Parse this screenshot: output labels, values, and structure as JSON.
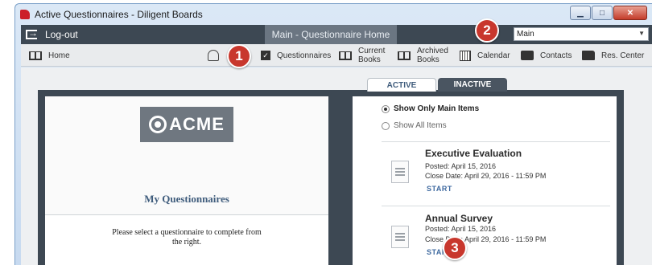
{
  "window": {
    "title": "Active Questionnaires - Diligent Boards"
  },
  "topbar": {
    "logout_label": "Log-out",
    "main_tab_label": "Main - Questionnaire Home",
    "book_select_value": "Main"
  },
  "nav": {
    "home": "Home",
    "questionnaires": "Questionnaires",
    "current_books": [
      "Current",
      "Books"
    ],
    "archived_books": [
      "Archived",
      "Books"
    ],
    "calendar": "Calendar",
    "contacts": "Contacts",
    "res_center": "Res. Center"
  },
  "tabs": {
    "active": "ACTIVE",
    "inactive": "INACTIVE"
  },
  "left_panel": {
    "logo_text": "ACME",
    "heading": "My Questionnaires",
    "instruction": "Please select a questionnaire to complete from the right."
  },
  "filters": {
    "main_items": "Show Only Main Items",
    "all_items": "Show All Items",
    "selected": "main_items"
  },
  "questionnaires": [
    {
      "title": "Executive Evaluation",
      "posted": "Posted: April 15, 2016",
      "close": "Close Date: April 29, 2016 - 11:59 PM",
      "action": "START"
    },
    {
      "title": "Annual Survey",
      "posted": "Posted: April 15, 2016",
      "close": "Close Date: April 29, 2016 - 11:59 PM",
      "action": "START"
    }
  ],
  "callouts": [
    "1",
    "2",
    "3"
  ],
  "colors": {
    "accent_red": "#c8372d",
    "dark_bar": "#3d4853",
    "link_blue": "#3f6aa0"
  }
}
